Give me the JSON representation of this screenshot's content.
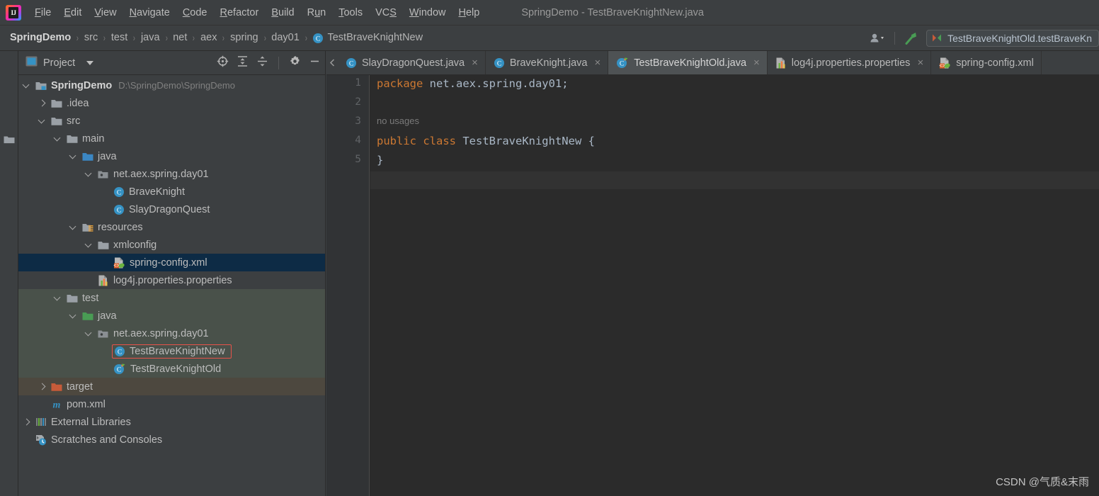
{
  "app": {
    "logo_text": "IJ",
    "window_title": "SpringDemo - TestBraveKnightNew.java"
  },
  "menubar": {
    "items": [
      {
        "label": "File",
        "mnemonic": "F"
      },
      {
        "label": "Edit",
        "mnemonic": "E"
      },
      {
        "label": "View",
        "mnemonic": "V"
      },
      {
        "label": "Navigate",
        "mnemonic": "N"
      },
      {
        "label": "Code",
        "mnemonic": "C"
      },
      {
        "label": "Refactor",
        "mnemonic": "R"
      },
      {
        "label": "Build",
        "mnemonic": "B"
      },
      {
        "label": "Run",
        "mnemonic": "u"
      },
      {
        "label": "Tools",
        "mnemonic": "T"
      },
      {
        "label": "VCS",
        "mnemonic": "S"
      },
      {
        "label": "Window",
        "mnemonic": "W"
      },
      {
        "label": "Help",
        "mnemonic": "H"
      }
    ]
  },
  "navbar": {
    "breadcrumbs": [
      {
        "label": "SpringDemo",
        "bold": true,
        "icon": ""
      },
      {
        "label": "src",
        "bold": false,
        "icon": ""
      },
      {
        "label": "test",
        "bold": false,
        "icon": ""
      },
      {
        "label": "java",
        "bold": false,
        "icon": ""
      },
      {
        "label": "net",
        "bold": false,
        "icon": ""
      },
      {
        "label": "aex",
        "bold": false,
        "icon": ""
      },
      {
        "label": "spring",
        "bold": false,
        "icon": ""
      },
      {
        "label": "day01",
        "bold": false,
        "icon": ""
      },
      {
        "label": "TestBraveKnightNew",
        "bold": false,
        "icon": "class-icon"
      }
    ],
    "separator": "›",
    "account_icon": "user-account-icon",
    "build_icon": "build-hammer-icon",
    "run_config": {
      "icon": "run-config-icon",
      "label": "TestBraveKnightOld.testBraveKn"
    }
  },
  "stripe": {
    "project_label": "Project",
    "project_icon": "folder-icon"
  },
  "toolwindow": {
    "icon": "project-view-icon",
    "title": "Project",
    "dropdown_icon": "chevron-down-icon",
    "actions": [
      {
        "name": "select-opened-file-icon"
      },
      {
        "name": "expand-all-icon"
      },
      {
        "name": "collapse-all-icon"
      },
      {
        "name": "settings-gear-icon"
      },
      {
        "name": "hide-minimize-icon"
      }
    ]
  },
  "tree": [
    {
      "label": "SpringDemo",
      "path": "D:\\SpringDemo\\SpringDemo",
      "indent": 0,
      "arrow": "open",
      "icon": "module-folder-icon",
      "bold": true,
      "state": "normal"
    },
    {
      "label": ".idea",
      "indent": 1,
      "arrow": "closed",
      "icon": "folder-icon",
      "state": "normal"
    },
    {
      "label": "src",
      "indent": 1,
      "arrow": "open",
      "icon": "folder-icon",
      "state": "normal"
    },
    {
      "label": "main",
      "indent": 2,
      "arrow": "open",
      "icon": "folder-icon",
      "state": "normal"
    },
    {
      "label": "java",
      "indent": 3,
      "arrow": "open",
      "icon": "source-root-icon",
      "state": "normal"
    },
    {
      "label": "net.aex.spring.day01",
      "indent": 4,
      "arrow": "open",
      "icon": "package-icon",
      "state": "normal"
    },
    {
      "label": "BraveKnight",
      "indent": 5,
      "arrow": "none",
      "icon": "class-icon",
      "state": "normal"
    },
    {
      "label": "SlayDragonQuest",
      "indent": 5,
      "arrow": "none",
      "icon": "class-icon",
      "state": "normal"
    },
    {
      "label": "resources",
      "indent": 3,
      "arrow": "open",
      "icon": "resource-root-icon",
      "state": "normal"
    },
    {
      "label": "xmlconfig",
      "indent": 4,
      "arrow": "open",
      "icon": "folder-icon",
      "state": "normal"
    },
    {
      "label": "spring-config.xml",
      "indent": 5,
      "arrow": "none",
      "icon": "spring-xml-icon",
      "state": "selected"
    },
    {
      "label": "log4j.properties.properties",
      "indent": 4,
      "arrow": "none",
      "icon": "properties-icon",
      "state": "normal"
    },
    {
      "label": "test",
      "indent": 2,
      "arrow": "open",
      "icon": "folder-icon",
      "state": "tint-test"
    },
    {
      "label": "java",
      "indent": 3,
      "arrow": "open",
      "icon": "test-source-root-icon",
      "state": "tint-test"
    },
    {
      "label": "net.aex.spring.day01",
      "indent": 4,
      "arrow": "open",
      "icon": "package-icon",
      "state": "tint-test"
    },
    {
      "label": "TestBraveKnightNew",
      "indent": 5,
      "arrow": "none",
      "icon": "class-icon",
      "state": "tint-test",
      "boxed": true
    },
    {
      "label": "TestBraveKnightOld",
      "indent": 5,
      "arrow": "none",
      "icon": "class-runnable-icon",
      "state": "tint-test"
    },
    {
      "label": "target",
      "indent": 1,
      "arrow": "closed",
      "icon": "excluded-folder-icon",
      "state": "tint-target"
    },
    {
      "label": "pom.xml",
      "indent": 1,
      "arrow": "none",
      "icon": "maven-icon",
      "state": "normal"
    },
    {
      "label": "External Libraries",
      "indent": 0,
      "arrow": "closed",
      "icon": "libraries-icon",
      "state": "normal"
    },
    {
      "label": "Scratches and Consoles",
      "indent": 0,
      "arrow": "none",
      "icon": "scratches-icon",
      "state": "normal"
    }
  ],
  "tabs": [
    {
      "label": "SlayDragonQuest.java",
      "icon": "class-icon",
      "active": false,
      "close": "×"
    },
    {
      "label": "BraveKnight.java",
      "icon": "class-icon",
      "active": false,
      "close": "×"
    },
    {
      "label": "TestBraveKnightOld.java",
      "icon": "class-runnable-icon",
      "active": true,
      "close": "×"
    },
    {
      "label": "log4j.properties.properties",
      "icon": "properties-icon",
      "active": false,
      "close": "×"
    },
    {
      "label": "spring-config.xml",
      "icon": "spring-xml-icon",
      "active": false,
      "close": ""
    }
  ],
  "editor": {
    "line_numbers": [
      "1",
      "2",
      "3",
      "4",
      "5"
    ],
    "caret_line": 5,
    "lines": [
      {
        "num": "1",
        "segments": [
          {
            "text": "package ",
            "type": "keyword"
          },
          {
            "text": "net.aex.spring.day01;",
            "type": "plain"
          }
        ]
      },
      {
        "num": "2",
        "segments": []
      },
      {
        "num": "3",
        "inlay": "no usages",
        "segments": [
          {
            "text": "public class ",
            "type": "keyword"
          },
          {
            "text": "TestBraveKnightNew ",
            "type": "classname"
          },
          {
            "text": "{",
            "type": "plain"
          }
        ]
      },
      {
        "num": "4",
        "segments": [
          {
            "text": "}",
            "type": "plain"
          }
        ]
      },
      {
        "num": "5",
        "segments": []
      }
    ]
  },
  "watermark": {
    "text": "CSDN @气质&末雨"
  },
  "colors": {
    "chrome": "#3c3f41",
    "editor_bg": "#2b2b2b",
    "gutter_bg": "#313335",
    "selection": "#0d2b45",
    "test_tint": "#49514a",
    "target_tint": "#4d483f",
    "keyword": "#cc7832",
    "plain_text": "#a9b7c6",
    "accent_red_box": "#e8534a",
    "class_icon": "#3592c4",
    "source_root": "#3b87c4",
    "test_root": "#499c54",
    "excluded": "#c75b39"
  }
}
